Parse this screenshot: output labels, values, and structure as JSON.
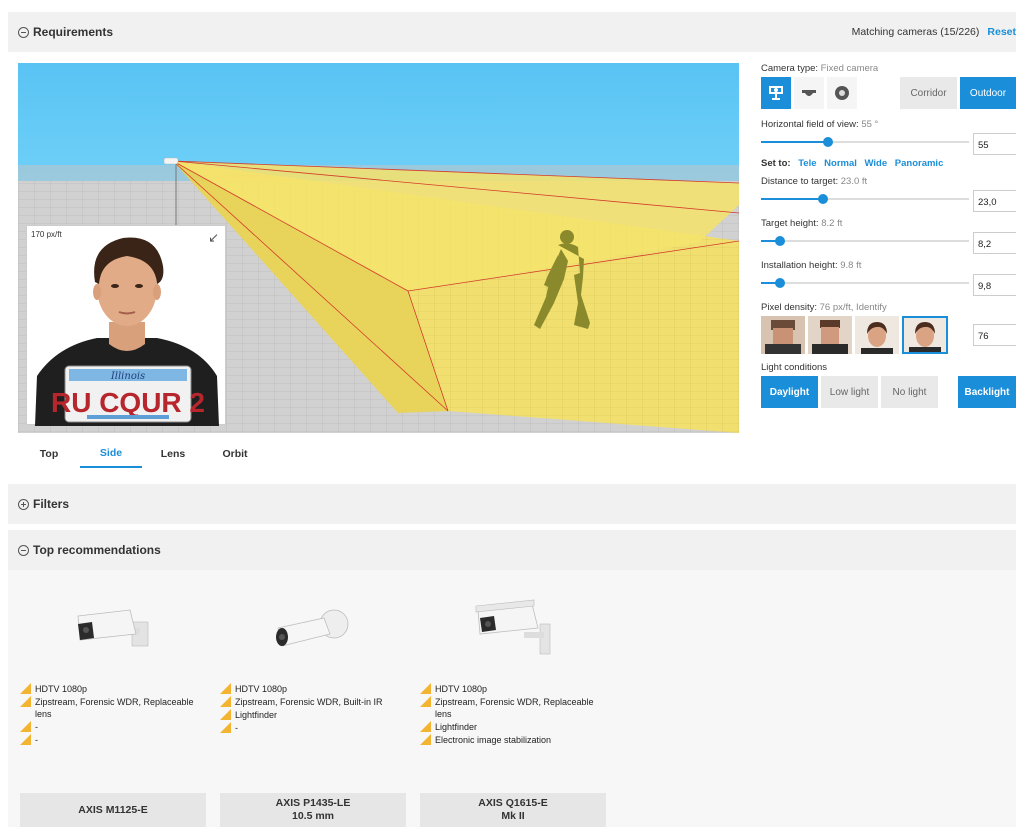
{
  "requirements": {
    "title": "Requirements",
    "matching": "Matching cameras (15/226)",
    "reset": "Reset"
  },
  "scene": {
    "pixel_label": "170 px/ft",
    "plate_state": "Illinois",
    "plate_text": "RU CQUR 2",
    "colors": {
      "sky": "#5cc3f2",
      "floor": "#cfcfcf",
      "fov": "#f4e25a",
      "person": "#8a8a2c"
    }
  },
  "view_tabs": [
    {
      "label": "Top",
      "active": false
    },
    {
      "label": "Side",
      "active": true
    },
    {
      "label": "Lens",
      "active": false
    },
    {
      "label": "Orbit",
      "active": false
    }
  ],
  "panel": {
    "camera_type": {
      "label": "Camera type:",
      "value": "Fixed camera",
      "icons": [
        "fixed-camera-icon",
        "dome-camera-icon",
        "ptz-camera-icon"
      ]
    },
    "corridor": "Corridor",
    "outdoor": "Outdoor",
    "hfov": {
      "label": "Horizontal field of view:",
      "value": "55 °",
      "input": "55",
      "fill": 0.32
    },
    "set_to": {
      "label": "Set to:",
      "options": [
        "Tele",
        "Normal",
        "Wide",
        "Panoramic"
      ]
    },
    "distance": {
      "label": "Distance to target:",
      "value": "23.0 ft",
      "input": "23,0",
      "fill": 0.3
    },
    "target_height": {
      "label": "Target height:",
      "value": "8.2 ft",
      "input": "8,2",
      "fill": 0.09
    },
    "install_height": {
      "label": "Installation height:",
      "value": "9.8 ft",
      "input": "9,8",
      "fill": 0.09
    },
    "pixel_density": {
      "label": "Pixel density:",
      "value": "76 px/ft, Identify",
      "input": "76"
    },
    "light": {
      "label": "Light conditions",
      "options": [
        {
          "label": "Daylight",
          "active": true
        },
        {
          "label": "Low light",
          "active": false
        },
        {
          "label": "No light",
          "active": false
        }
      ],
      "backlight": "Backlight"
    },
    "accent": "#1a8ed8"
  },
  "filters": {
    "title": "Filters"
  },
  "recommendations": {
    "title": "Top recommendations",
    "items": [
      {
        "features": [
          "HDTV 1080p",
          "Zipstream, Forensic WDR, Replaceable lens",
          "-",
          "-"
        ],
        "name_line1": "AXIS M1125-E",
        "name_line2": ""
      },
      {
        "features": [
          "HDTV 1080p",
          "Zipstream, Forensic WDR, Built-in IR",
          "Lightfinder",
          "-"
        ],
        "name_line1": "AXIS P1435-LE",
        "name_line2": "10.5 mm"
      },
      {
        "features": [
          "HDTV 1080p",
          "Zipstream, Forensic WDR, Replaceable lens",
          "Lightfinder",
          "Electronic image stabilization"
        ],
        "name_line1": "AXIS Q1615-E",
        "name_line2": "Mk II"
      }
    ]
  }
}
